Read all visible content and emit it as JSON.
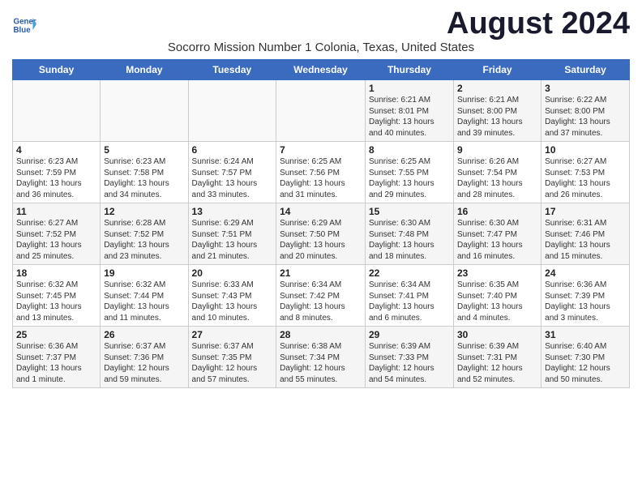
{
  "header": {
    "logo_line1": "General",
    "logo_line2": "Blue",
    "month_year": "August 2024",
    "location": "Socorro Mission Number 1 Colonia, Texas, United States"
  },
  "weekdays": [
    "Sunday",
    "Monday",
    "Tuesday",
    "Wednesday",
    "Thursday",
    "Friday",
    "Saturday"
  ],
  "weeks": [
    [
      {
        "day": "",
        "info": ""
      },
      {
        "day": "",
        "info": ""
      },
      {
        "day": "",
        "info": ""
      },
      {
        "day": "",
        "info": ""
      },
      {
        "day": "1",
        "info": "Sunrise: 6:21 AM\nSunset: 8:01 PM\nDaylight: 13 hours\nand 40 minutes."
      },
      {
        "day": "2",
        "info": "Sunrise: 6:21 AM\nSunset: 8:00 PM\nDaylight: 13 hours\nand 39 minutes."
      },
      {
        "day": "3",
        "info": "Sunrise: 6:22 AM\nSunset: 8:00 PM\nDaylight: 13 hours\nand 37 minutes."
      }
    ],
    [
      {
        "day": "4",
        "info": "Sunrise: 6:23 AM\nSunset: 7:59 PM\nDaylight: 13 hours\nand 36 minutes."
      },
      {
        "day": "5",
        "info": "Sunrise: 6:23 AM\nSunset: 7:58 PM\nDaylight: 13 hours\nand 34 minutes."
      },
      {
        "day": "6",
        "info": "Sunrise: 6:24 AM\nSunset: 7:57 PM\nDaylight: 13 hours\nand 33 minutes."
      },
      {
        "day": "7",
        "info": "Sunrise: 6:25 AM\nSunset: 7:56 PM\nDaylight: 13 hours\nand 31 minutes."
      },
      {
        "day": "8",
        "info": "Sunrise: 6:25 AM\nSunset: 7:55 PM\nDaylight: 13 hours\nand 29 minutes."
      },
      {
        "day": "9",
        "info": "Sunrise: 6:26 AM\nSunset: 7:54 PM\nDaylight: 13 hours\nand 28 minutes."
      },
      {
        "day": "10",
        "info": "Sunrise: 6:27 AM\nSunset: 7:53 PM\nDaylight: 13 hours\nand 26 minutes."
      }
    ],
    [
      {
        "day": "11",
        "info": "Sunrise: 6:27 AM\nSunset: 7:52 PM\nDaylight: 13 hours\nand 25 minutes."
      },
      {
        "day": "12",
        "info": "Sunrise: 6:28 AM\nSunset: 7:52 PM\nDaylight: 13 hours\nand 23 minutes."
      },
      {
        "day": "13",
        "info": "Sunrise: 6:29 AM\nSunset: 7:51 PM\nDaylight: 13 hours\nand 21 minutes."
      },
      {
        "day": "14",
        "info": "Sunrise: 6:29 AM\nSunset: 7:50 PM\nDaylight: 13 hours\nand 20 minutes."
      },
      {
        "day": "15",
        "info": "Sunrise: 6:30 AM\nSunset: 7:48 PM\nDaylight: 13 hours\nand 18 minutes."
      },
      {
        "day": "16",
        "info": "Sunrise: 6:30 AM\nSunset: 7:47 PM\nDaylight: 13 hours\nand 16 minutes."
      },
      {
        "day": "17",
        "info": "Sunrise: 6:31 AM\nSunset: 7:46 PM\nDaylight: 13 hours\nand 15 minutes."
      }
    ],
    [
      {
        "day": "18",
        "info": "Sunrise: 6:32 AM\nSunset: 7:45 PM\nDaylight: 13 hours\nand 13 minutes."
      },
      {
        "day": "19",
        "info": "Sunrise: 6:32 AM\nSunset: 7:44 PM\nDaylight: 13 hours\nand 11 minutes."
      },
      {
        "day": "20",
        "info": "Sunrise: 6:33 AM\nSunset: 7:43 PM\nDaylight: 13 hours\nand 10 minutes."
      },
      {
        "day": "21",
        "info": "Sunrise: 6:34 AM\nSunset: 7:42 PM\nDaylight: 13 hours\nand 8 minutes."
      },
      {
        "day": "22",
        "info": "Sunrise: 6:34 AM\nSunset: 7:41 PM\nDaylight: 13 hours\nand 6 minutes."
      },
      {
        "day": "23",
        "info": "Sunrise: 6:35 AM\nSunset: 7:40 PM\nDaylight: 13 hours\nand 4 minutes."
      },
      {
        "day": "24",
        "info": "Sunrise: 6:36 AM\nSunset: 7:39 PM\nDaylight: 13 hours\nand 3 minutes."
      }
    ],
    [
      {
        "day": "25",
        "info": "Sunrise: 6:36 AM\nSunset: 7:37 PM\nDaylight: 13 hours\nand 1 minute."
      },
      {
        "day": "26",
        "info": "Sunrise: 6:37 AM\nSunset: 7:36 PM\nDaylight: 12 hours\nand 59 minutes."
      },
      {
        "day": "27",
        "info": "Sunrise: 6:37 AM\nSunset: 7:35 PM\nDaylight: 12 hours\nand 57 minutes."
      },
      {
        "day": "28",
        "info": "Sunrise: 6:38 AM\nSunset: 7:34 PM\nDaylight: 12 hours\nand 55 minutes."
      },
      {
        "day": "29",
        "info": "Sunrise: 6:39 AM\nSunset: 7:33 PM\nDaylight: 12 hours\nand 54 minutes."
      },
      {
        "day": "30",
        "info": "Sunrise: 6:39 AM\nSunset: 7:31 PM\nDaylight: 12 hours\nand 52 minutes."
      },
      {
        "day": "31",
        "info": "Sunrise: 6:40 AM\nSunset: 7:30 PM\nDaylight: 12 hours\nand 50 minutes."
      }
    ]
  ]
}
